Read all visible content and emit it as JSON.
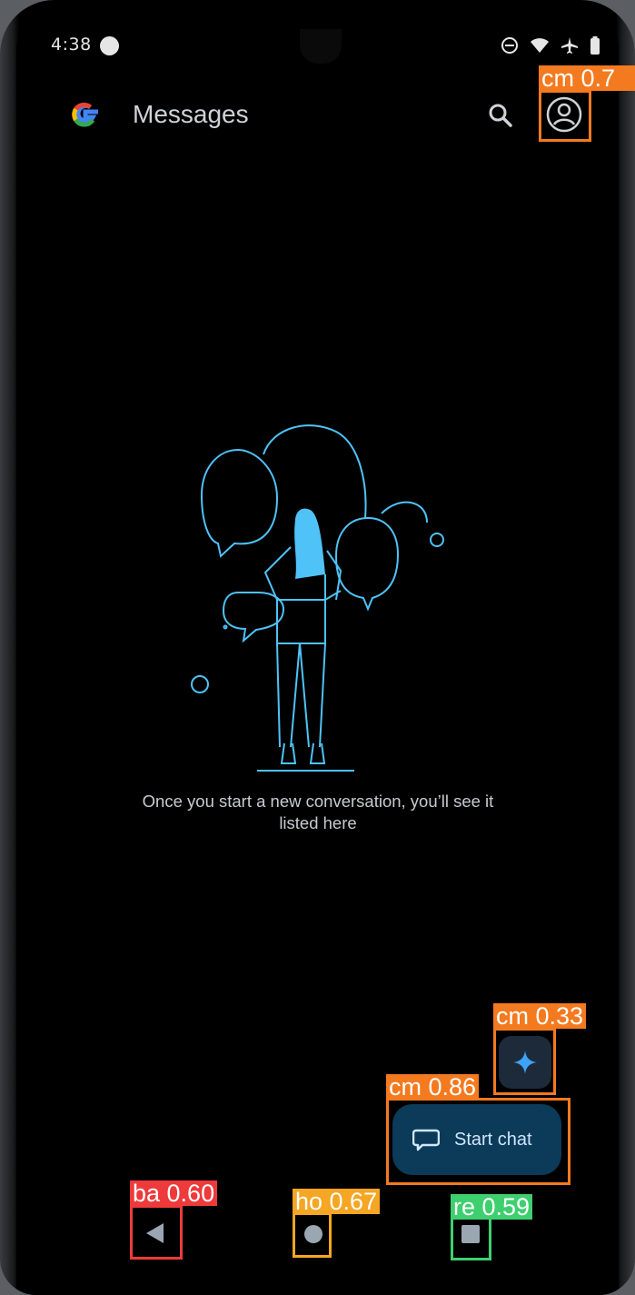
{
  "status_bar": {
    "time": "4:38"
  },
  "app_bar": {
    "title": "Messages"
  },
  "empty_state": {
    "message_line1": "Once you start a new conversation, you’ll see it",
    "message_line2": "listed here"
  },
  "fab": {
    "start_chat_label": "Start chat"
  },
  "detections": {
    "account": "cm  0.7",
    "sparkle": "cm  0.33",
    "start_chat": "cm  0.86",
    "back": "ba  0.60",
    "home": "ho  0.67",
    "recents": "re  0.59"
  },
  "colors": {
    "background": "#000000",
    "accent": "#4fc3f7",
    "fab_background": "#0c3a59",
    "detection_orange": "#f47a1f",
    "detection_red": "#ee3a3a",
    "detection_amber": "#f5a623",
    "detection_green": "#3ecf6f"
  },
  "icons": {
    "left_status": "media-icon",
    "right_status": [
      "do-not-disturb-icon",
      "wifi-icon",
      "airplane-icon",
      "battery-icon"
    ],
    "search": "search-icon",
    "account": "account-circle-icon",
    "sparkle": "sparkle-icon",
    "chat": "chat-bubble-icon",
    "back": "back-triangle-icon",
    "home": "home-circle-icon",
    "recents": "recents-square-icon"
  }
}
